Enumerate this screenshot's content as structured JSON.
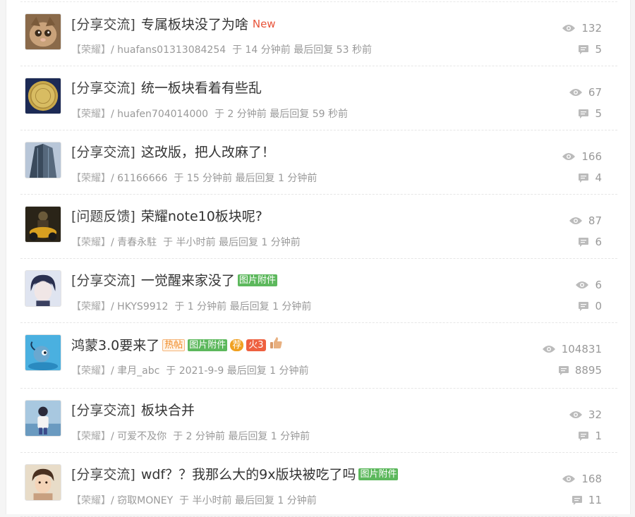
{
  "threads": [
    {
      "category": "[分享交流]",
      "title": "专属板块没了为啥",
      "new_label": "New",
      "forum": "【荣耀】",
      "sep": "/",
      "author": "huafans01313084254",
      "time_text": "于 14 分钟前 最后回复 53 秒前",
      "views": "132",
      "replies": "5"
    },
    {
      "category": "[分享交流]",
      "title": "统一板块看着有些乱",
      "forum": "【荣耀】",
      "sep": "/",
      "author": "huafen704014000",
      "time_text": "于 2 分钟前 最后回复 59 秒前",
      "views": "67",
      "replies": "5"
    },
    {
      "category": "[分享交流]",
      "title": "这改版，把人改麻了！",
      "forum": "【荣耀】",
      "sep": "/",
      "author": "61166666",
      "time_text": "于 15 分钟前 最后回复 1 分钟前",
      "views": "166",
      "replies": "4"
    },
    {
      "category": "[问题反馈]",
      "title": "荣耀note10板块呢?",
      "forum": "【荣耀】",
      "sep": "/",
      "author": "青春永駐",
      "time_text": "于 半小时前 最后回复 1 分钟前",
      "views": "87",
      "replies": "6"
    },
    {
      "category": "[分享交流]",
      "title": "一觉醒来家没了",
      "badge_img": "图片附件",
      "forum": "【荣耀】",
      "sep": "/",
      "author": "HKYS9912",
      "time_text": "于 1 分钟前 最后回复 1 分钟前",
      "views": "6",
      "replies": "0"
    },
    {
      "title": "鸿蒙3.0要来了",
      "badge_hot": "热帖",
      "badge_img": "图片附件",
      "badge_rec": "荐",
      "badge_fire": "火3",
      "forum": "【荣耀】",
      "sep": "/",
      "author": "聿月_abc",
      "time_text": "于 2021-9-9 最后回复 1 分钟前",
      "views": "104831",
      "replies": "8895"
    },
    {
      "category": "[分享交流]",
      "title": "板块合并",
      "forum": "【荣耀】",
      "sep": "/",
      "author": "可爱不及你",
      "time_text": "于 2 分钟前 最后回复 1 分钟前",
      "views": "32",
      "replies": "1"
    },
    {
      "category": "[分享交流]",
      "title": "wdf？？我那么大的9x版块被吃了吗",
      "badge_img": "图片附件",
      "forum": "【荣耀】",
      "sep": "/",
      "author": "窃取MONEY",
      "time_text": "于 半小时前 最后回复 1 分钟前",
      "views": "168",
      "replies": "11"
    }
  ],
  "colors": {
    "new_tag": "#e8543a",
    "image_badge": "#5cb85c",
    "muted_text": "#999999"
  },
  "icons": {
    "views": "eye-icon",
    "replies": "comment-icon",
    "thumbs_up": "thumbs-up-icon"
  }
}
